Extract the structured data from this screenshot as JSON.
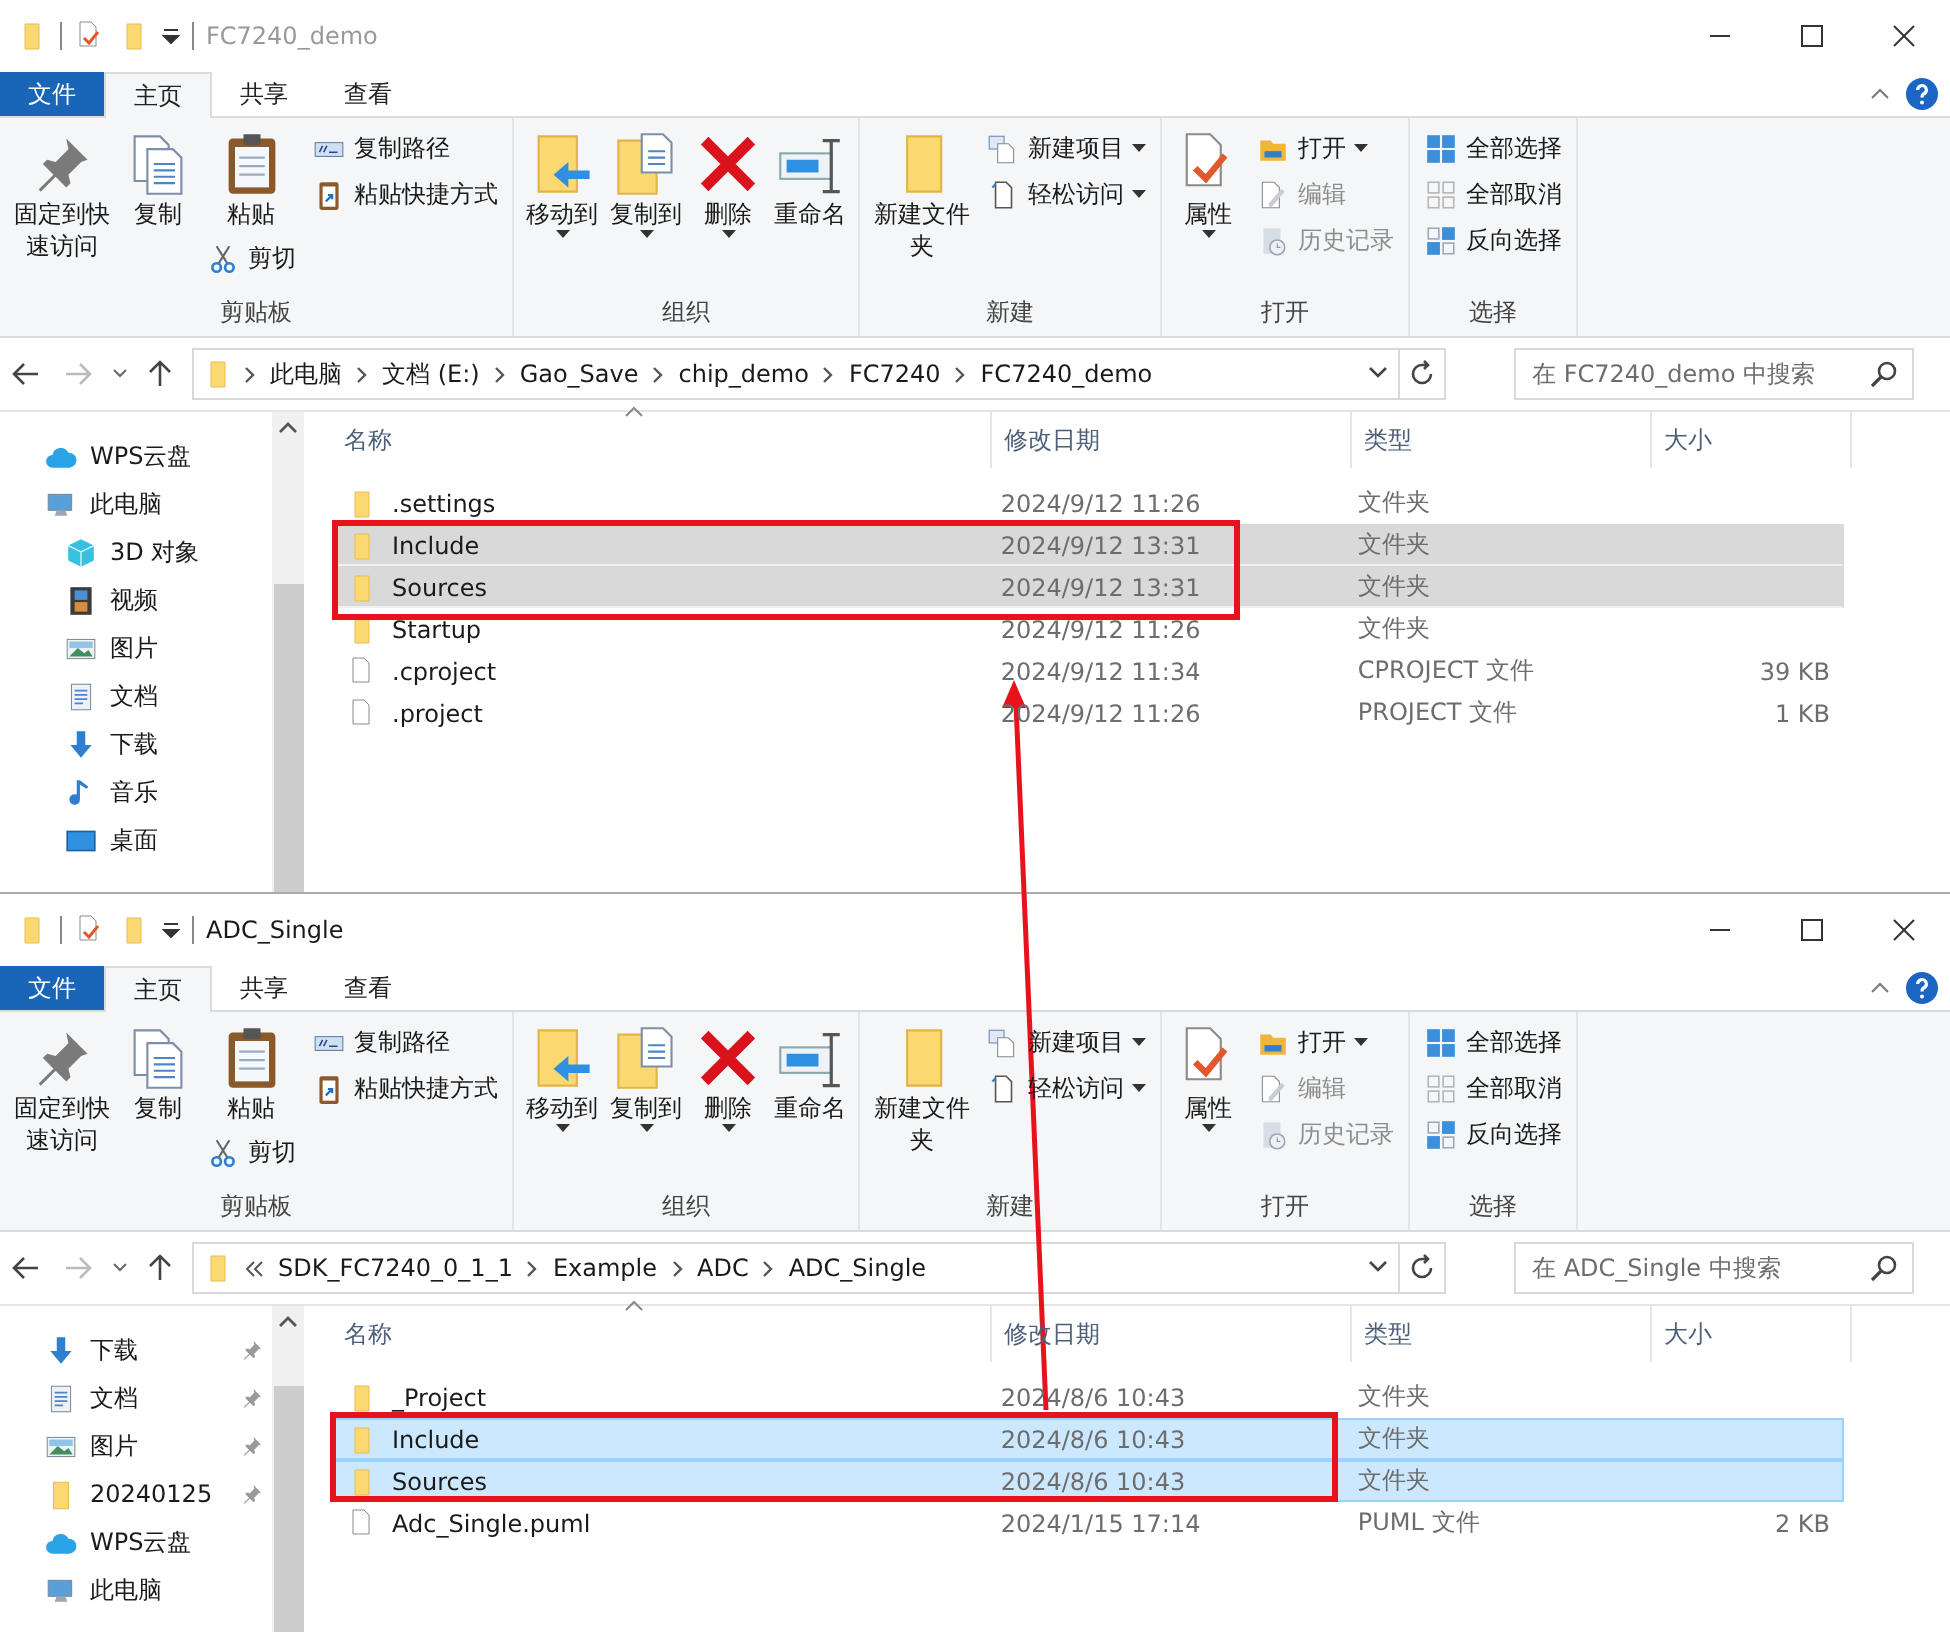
{
  "windows": [
    {
      "title": "FC7240_demo",
      "active": false,
      "tabs": [
        {
          "label": "文件",
          "kind": "file",
          "selected": false
        },
        {
          "label": "主页",
          "kind": "tab",
          "selected": true
        },
        {
          "label": "共享",
          "kind": "tab",
          "selected": false
        },
        {
          "label": "查看",
          "kind": "tab",
          "selected": false
        }
      ],
      "ribbon": [
        {
          "label": "剪贴板",
          "columns": [
            [
              {
                "label": "固定到快速访问",
                "kind": "large",
                "dropdown": false,
                "disabled": false
              }
            ],
            [
              {
                "label": "复制",
                "kind": "large",
                "dropdown": false,
                "disabled": false
              }
            ],
            [
              {
                "label": "粘贴",
                "kind": "large",
                "dropdown": false,
                "disabled": false
              },
              {
                "label": "剪切",
                "kind": "small",
                "dropdown": false,
                "disabled": false
              }
            ],
            [
              {
                "label": "复制路径",
                "kind": "small",
                "dropdown": false,
                "disabled": false
              },
              {
                "label": "粘贴快捷方式",
                "kind": "small",
                "dropdown": false,
                "disabled": false
              }
            ]
          ]
        },
        {
          "label": "组织",
          "columns": [
            [
              {
                "label": "移动到",
                "kind": "large",
                "dropdown": true,
                "disabled": false
              }
            ],
            [
              {
                "label": "复制到",
                "kind": "large",
                "dropdown": true,
                "disabled": false
              }
            ],
            [
              {
                "label": "删除",
                "kind": "large",
                "dropdown": true,
                "disabled": false
              }
            ],
            [
              {
                "label": "重命名",
                "kind": "large",
                "dropdown": false,
                "disabled": false
              }
            ]
          ]
        },
        {
          "label": "新建",
          "columns": [
            [
              {
                "label": "新建文件夹",
                "kind": "large",
                "dropdown": false,
                "disabled": false
              }
            ],
            [
              {
                "label": "新建项目",
                "kind": "small",
                "dropdown": true,
                "disabled": false
              },
              {
                "label": "轻松访问",
                "kind": "small",
                "dropdown": true,
                "disabled": false
              }
            ]
          ]
        },
        {
          "label": "打开",
          "columns": [
            [
              {
                "label": "属性",
                "kind": "large",
                "dropdown": true,
                "disabled": false
              }
            ],
            [
              {
                "label": "打开",
                "kind": "small",
                "dropdown": true,
                "disabled": false
              },
              {
                "label": "编辑",
                "kind": "small",
                "dropdown": false,
                "disabled": true
              },
              {
                "label": "历史记录",
                "kind": "small",
                "dropdown": false,
                "disabled": true
              }
            ]
          ]
        },
        {
          "label": "选择",
          "columns": [
            [
              {
                "label": "全部选择",
                "kind": "small",
                "dropdown": false,
                "disabled": false
              },
              {
                "label": "全部取消",
                "kind": "small",
                "dropdown": false,
                "disabled": false
              },
              {
                "label": "反向选择",
                "kind": "small",
                "dropdown": false,
                "disabled": false
              }
            ]
          ]
        }
      ],
      "address": {
        "truncated": false,
        "crumbs": [
          "此电脑",
          "文档 (E:)",
          "Gao_Save",
          "chip_demo",
          "FC7240",
          "FC7240_demo"
        ]
      },
      "search": {
        "placeholder": "在 FC7240_demo 中搜索"
      },
      "nav": [
        {
          "label": "WPS云盘",
          "kind": "cloud",
          "pinned": false
        },
        {
          "label": "此电脑",
          "kind": "pc",
          "pinned": false,
          "children": [
            {
              "label": "3D 对象",
              "kind": "cube",
              "pinned": false
            },
            {
              "label": "视频",
              "kind": "film",
              "pinned": false
            },
            {
              "label": "图片",
              "kind": "image",
              "pinned": false
            },
            {
              "label": "文档",
              "kind": "doc",
              "pinned": false
            },
            {
              "label": "下载",
              "kind": "download",
              "pinned": false
            },
            {
              "label": "音乐",
              "kind": "music",
              "pinned": false
            },
            {
              "label": "桌面",
              "kind": "desktop",
              "pinned": false
            }
          ]
        }
      ],
      "columns": [
        "名称",
        "修改日期",
        "类型",
        "大小"
      ],
      "rows": [
        {
          "name": ".settings",
          "date": "2024/9/12 11:26",
          "type": "文件夹",
          "kind": "folder",
          "selected": false
        },
        {
          "name": "Include",
          "date": "2024/9/12 13:31",
          "type": "文件夹",
          "kind": "folder",
          "selected": true
        },
        {
          "name": "Sources",
          "date": "2024/9/12 13:31",
          "type": "文件夹",
          "kind": "folder",
          "selected": true
        },
        {
          "name": "Startup",
          "date": "2024/9/12 11:26",
          "type": "文件夹",
          "kind": "folder",
          "selected": false
        },
        {
          "name": ".cproject",
          "date": "2024/9/12 11:34",
          "type": "CPROJECT 文件",
          "size": "39 KB",
          "kind": "file",
          "selected": false
        },
        {
          "name": ".project",
          "date": "2024/9/12 11:26",
          "type": "PROJECT 文件",
          "size": "1 KB",
          "kind": "file",
          "selected": false
        }
      ]
    },
    {
      "title": "ADC_Single",
      "active": true,
      "tabs": [
        {
          "label": "文件",
          "kind": "file",
          "selected": false
        },
        {
          "label": "主页",
          "kind": "tab",
          "selected": true
        },
        {
          "label": "共享",
          "kind": "tab",
          "selected": false
        },
        {
          "label": "查看",
          "kind": "tab",
          "selected": false
        }
      ],
      "ribbon": [
        {
          "label": "剪贴板",
          "columns": [
            [
              {
                "label": "固定到快速访问",
                "kind": "large",
                "dropdown": false,
                "disabled": false
              }
            ],
            [
              {
                "label": "复制",
                "kind": "large",
                "dropdown": false,
                "disabled": false
              }
            ],
            [
              {
                "label": "粘贴",
                "kind": "large",
                "dropdown": false,
                "disabled": false
              },
              {
                "label": "剪切",
                "kind": "small",
                "dropdown": false,
                "disabled": false
              }
            ],
            [
              {
                "label": "复制路径",
                "kind": "small",
                "dropdown": false,
                "disabled": false
              },
              {
                "label": "粘贴快捷方式",
                "kind": "small",
                "dropdown": false,
                "disabled": false
              }
            ]
          ]
        },
        {
          "label": "组织",
          "columns": [
            [
              {
                "label": "移动到",
                "kind": "large",
                "dropdown": true,
                "disabled": false
              }
            ],
            [
              {
                "label": "复制到",
                "kind": "large",
                "dropdown": true,
                "disabled": false
              }
            ],
            [
              {
                "label": "删除",
                "kind": "large",
                "dropdown": true,
                "disabled": false
              }
            ],
            [
              {
                "label": "重命名",
                "kind": "large",
                "dropdown": false,
                "disabled": false
              }
            ]
          ]
        },
        {
          "label": "新建",
          "columns": [
            [
              {
                "label": "新建文件夹",
                "kind": "large",
                "dropdown": false,
                "disabled": false
              }
            ],
            [
              {
                "label": "新建项目",
                "kind": "small",
                "dropdown": true,
                "disabled": false
              },
              {
                "label": "轻松访问",
                "kind": "small",
                "dropdown": true,
                "disabled": false
              }
            ]
          ]
        },
        {
          "label": "打开",
          "columns": [
            [
              {
                "label": "属性",
                "kind": "large",
                "dropdown": true,
                "disabled": false
              }
            ],
            [
              {
                "label": "打开",
                "kind": "small",
                "dropdown": true,
                "disabled": false
              },
              {
                "label": "编辑",
                "kind": "small",
                "dropdown": false,
                "disabled": true
              },
              {
                "label": "历史记录",
                "kind": "small",
                "dropdown": false,
                "disabled": true
              }
            ]
          ]
        },
        {
          "label": "选择",
          "columns": [
            [
              {
                "label": "全部选择",
                "kind": "small",
                "dropdown": false,
                "disabled": false
              },
              {
                "label": "全部取消",
                "kind": "small",
                "dropdown": false,
                "disabled": false
              },
              {
                "label": "反向选择",
                "kind": "small",
                "dropdown": false,
                "disabled": false
              }
            ]
          ]
        }
      ],
      "address": {
        "truncated": true,
        "crumbs": [
          "SDK_FC7240_0_1_1",
          "Example",
          "ADC",
          "ADC_Single"
        ]
      },
      "search": {
        "placeholder": "在 ADC_Single 中搜索"
      },
      "nav": [
        {
          "label": "下载",
          "kind": "download",
          "pinned": true
        },
        {
          "label": "文档",
          "kind": "doc",
          "pinned": true
        },
        {
          "label": "图片",
          "kind": "image",
          "pinned": true
        },
        {
          "label": "20240125",
          "kind": "folder",
          "pinned": true
        },
        {
          "label": "WPS云盘",
          "kind": "cloud",
          "pinned": false
        },
        {
          "label": "此电脑",
          "kind": "pc",
          "pinned": false
        }
      ],
      "columns": [
        "名称",
        "修改日期",
        "类型",
        "大小"
      ],
      "rows": [
        {
          "name": "_Project",
          "date": "2024/8/6 10:43",
          "type": "文件夹",
          "kind": "folder",
          "selected": false
        },
        {
          "name": "Include",
          "date": "2024/8/6 10:43",
          "type": "文件夹",
          "kind": "folder",
          "selected": true
        },
        {
          "name": "Sources",
          "date": "2024/8/6 10:43",
          "type": "文件夹",
          "kind": "folder",
          "selected": true
        },
        {
          "name": "Adc_Single.puml",
          "date": "2024/1/15 17:14",
          "type": "PUML 文件",
          "size": "2 KB",
          "kind": "file",
          "selected": false
        }
      ]
    }
  ]
}
